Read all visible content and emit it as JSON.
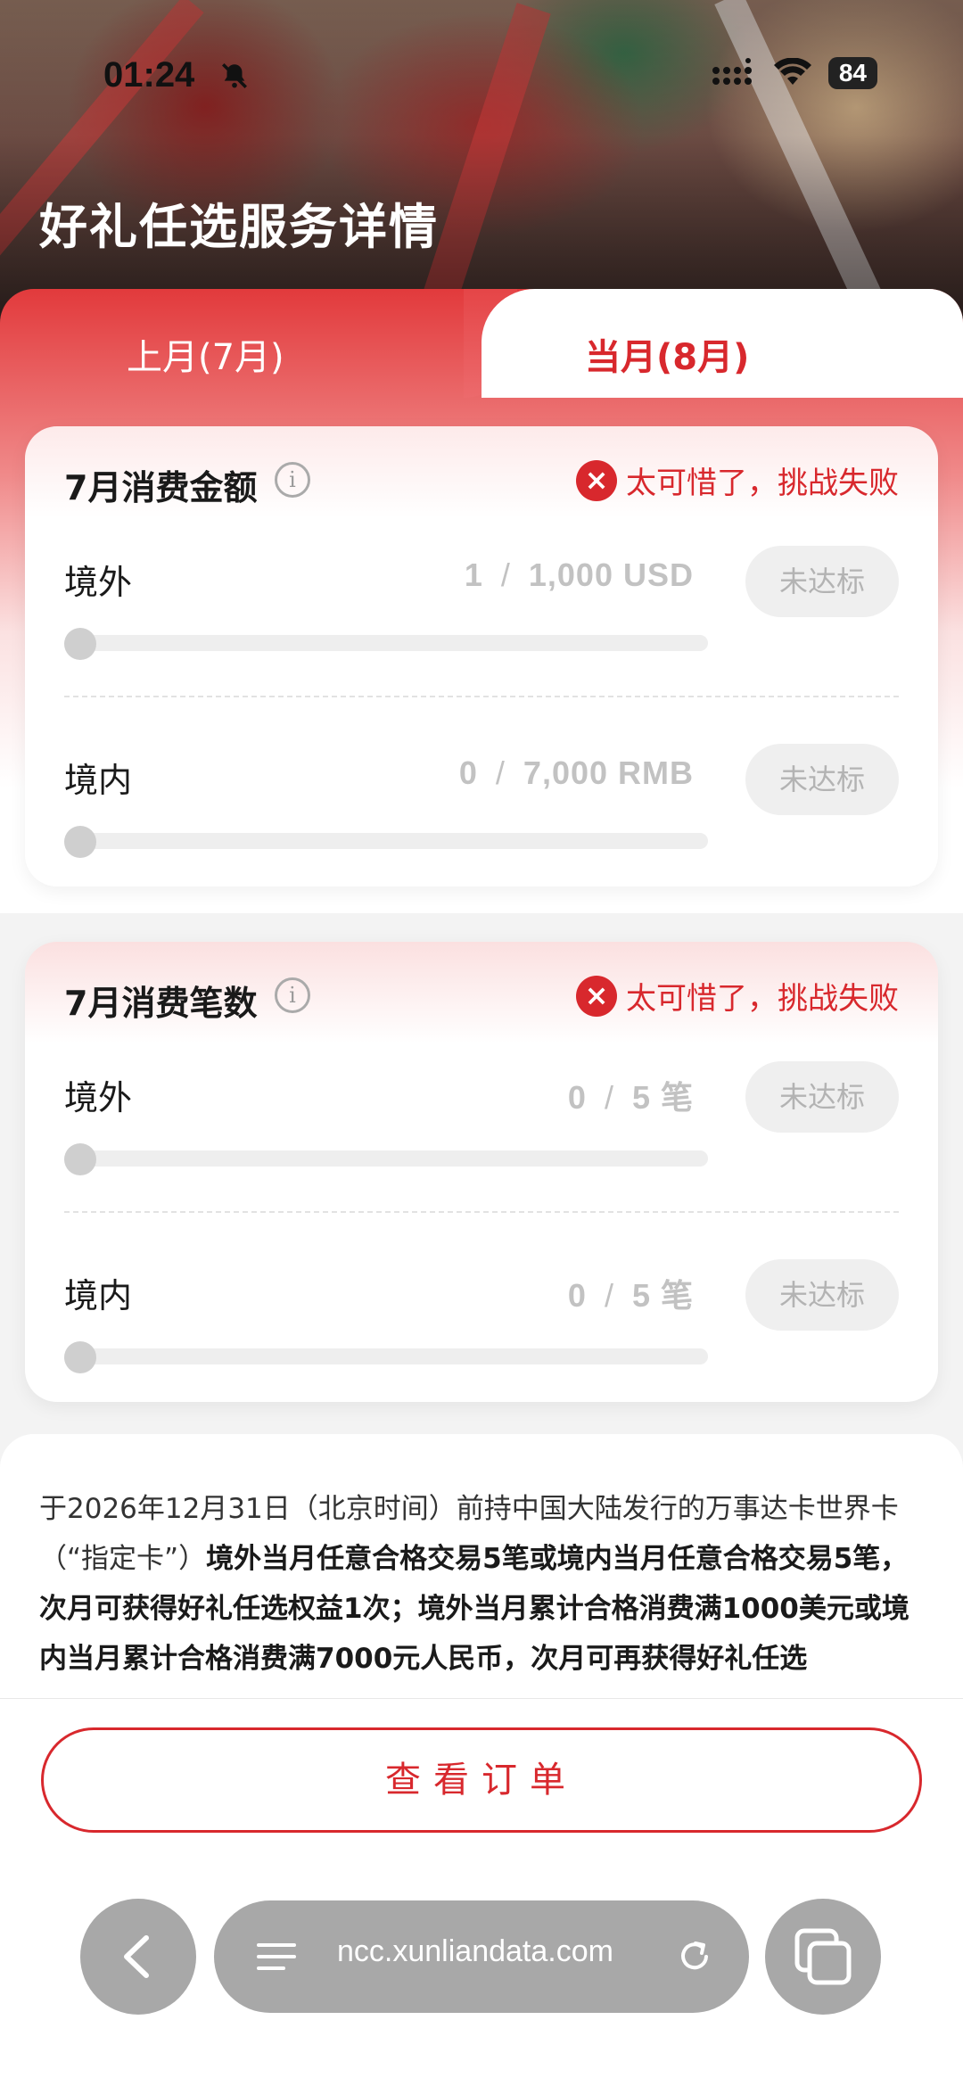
{
  "status_bar": {
    "time": "01:24",
    "battery": "84",
    "icons": [
      "bell-slash-icon",
      "signal-icon",
      "wifi-icon",
      "battery-icon"
    ]
  },
  "header": {
    "title": "好礼任选服务详情"
  },
  "tabs": [
    {
      "label": "上月(7月)",
      "active": false
    },
    {
      "label": "当月(8月)",
      "active": true
    }
  ],
  "cards": [
    {
      "title": "7月消费金额",
      "status": "太可惜了，挑战失败",
      "rows": [
        {
          "label": "境外",
          "current": "1",
          "target": "1,000 USD",
          "button": "未达标",
          "progress": 0.001
        },
        {
          "label": "境内",
          "current": "0",
          "target": "7,000 RMB",
          "button": "未达标",
          "progress": 0
        }
      ]
    },
    {
      "title": "7月消费笔数",
      "status": "太可惜了，挑战失败",
      "rows": [
        {
          "label": "境外",
          "current": "0",
          "target": "5 笔",
          "button": "未达标",
          "progress": 0
        },
        {
          "label": "境内",
          "current": "0",
          "target": "5 笔",
          "button": "未达标",
          "progress": 0
        }
      ]
    }
  ],
  "description": {
    "part1": "于2026年12月31日（北京时间）前持中国大陆发行的万事达卡世界卡（“指定卡”）",
    "part2": "境外当月任意合格交易5笔或境内当月任意合格交易5笔，次月可获得好礼任选权益1次；境外当月累计合格消费满1000美元或境内当月累计合格消费满7000元人民币，次月可再获得好礼任选"
  },
  "order_button": "查看订单",
  "browser": {
    "url": "ncc.xunliandata.com"
  },
  "colors": {
    "accent": "#d8282d",
    "muted": "#c2c2c2"
  }
}
